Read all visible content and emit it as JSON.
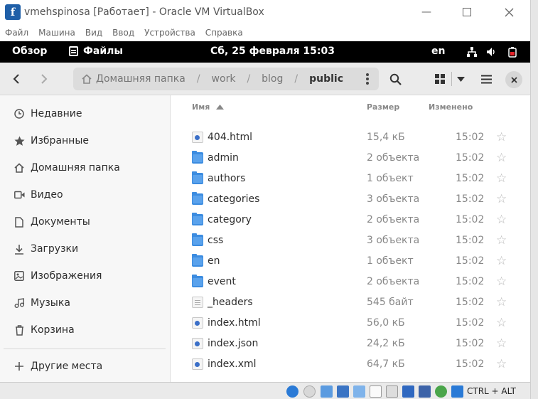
{
  "host": {
    "title": "vmehspinosa [Работает] - Oracle VM VirtualBox",
    "menu": [
      "Файл",
      "Машина",
      "Вид",
      "Ввод",
      "Устройства",
      "Справка"
    ],
    "host_key": "CTRL + ALT"
  },
  "topbar": {
    "overview": "Обзор",
    "app": "Файлы",
    "clock": "Сб, 25 февраля  15:03",
    "lang": "en"
  },
  "pathbar": {
    "segments": [
      "Домашняя папка",
      "work",
      "blog",
      "public"
    ]
  },
  "sidebar": {
    "items": [
      {
        "label": "Недавние",
        "icon": "clock-icon"
      },
      {
        "label": "Избранные",
        "icon": "star-icon"
      },
      {
        "label": "Домашняя папка",
        "icon": "home-icon"
      },
      {
        "label": "Видео",
        "icon": "video-icon"
      },
      {
        "label": "Документы",
        "icon": "document-icon"
      },
      {
        "label": "Загрузки",
        "icon": "download-icon"
      },
      {
        "label": "Изображения",
        "icon": "image-icon"
      },
      {
        "label": "Музыка",
        "icon": "music-icon"
      },
      {
        "label": "Корзина",
        "icon": "trash-icon"
      }
    ],
    "other": "Другие места"
  },
  "columns": {
    "name": "Имя",
    "size": "Размер",
    "modified": "Изменено"
  },
  "files": [
    {
      "name": "404.html",
      "size": "15,4 кБ",
      "time": "15:02",
      "type": "web"
    },
    {
      "name": "admin",
      "size": "2 объекта",
      "time": "15:02",
      "type": "folder"
    },
    {
      "name": "authors",
      "size": "1 объект",
      "time": "15:02",
      "type": "folder"
    },
    {
      "name": "categories",
      "size": "3 объекта",
      "time": "15:02",
      "type": "folder"
    },
    {
      "name": "category",
      "size": "2 объекта",
      "time": "15:02",
      "type": "folder"
    },
    {
      "name": "css",
      "size": "3 объекта",
      "time": "15:02",
      "type": "folder"
    },
    {
      "name": "en",
      "size": "1 объект",
      "time": "15:02",
      "type": "folder"
    },
    {
      "name": "event",
      "size": "2 объекта",
      "time": "15:02",
      "type": "folder"
    },
    {
      "name": "_headers",
      "size": "545 байт",
      "time": "15:02",
      "type": "text"
    },
    {
      "name": "index.html",
      "size": "56,0 кБ",
      "time": "15:02",
      "type": "web"
    },
    {
      "name": "index.json",
      "size": "24,2 кБ",
      "time": "15:02",
      "type": "web"
    },
    {
      "name": "index.xml",
      "size": "64,7 кБ",
      "time": "15:02",
      "type": "web"
    }
  ],
  "colors": {
    "folder": "#3c8ce0",
    "topbar": "#000000",
    "headerbar": "#ebebeb"
  }
}
